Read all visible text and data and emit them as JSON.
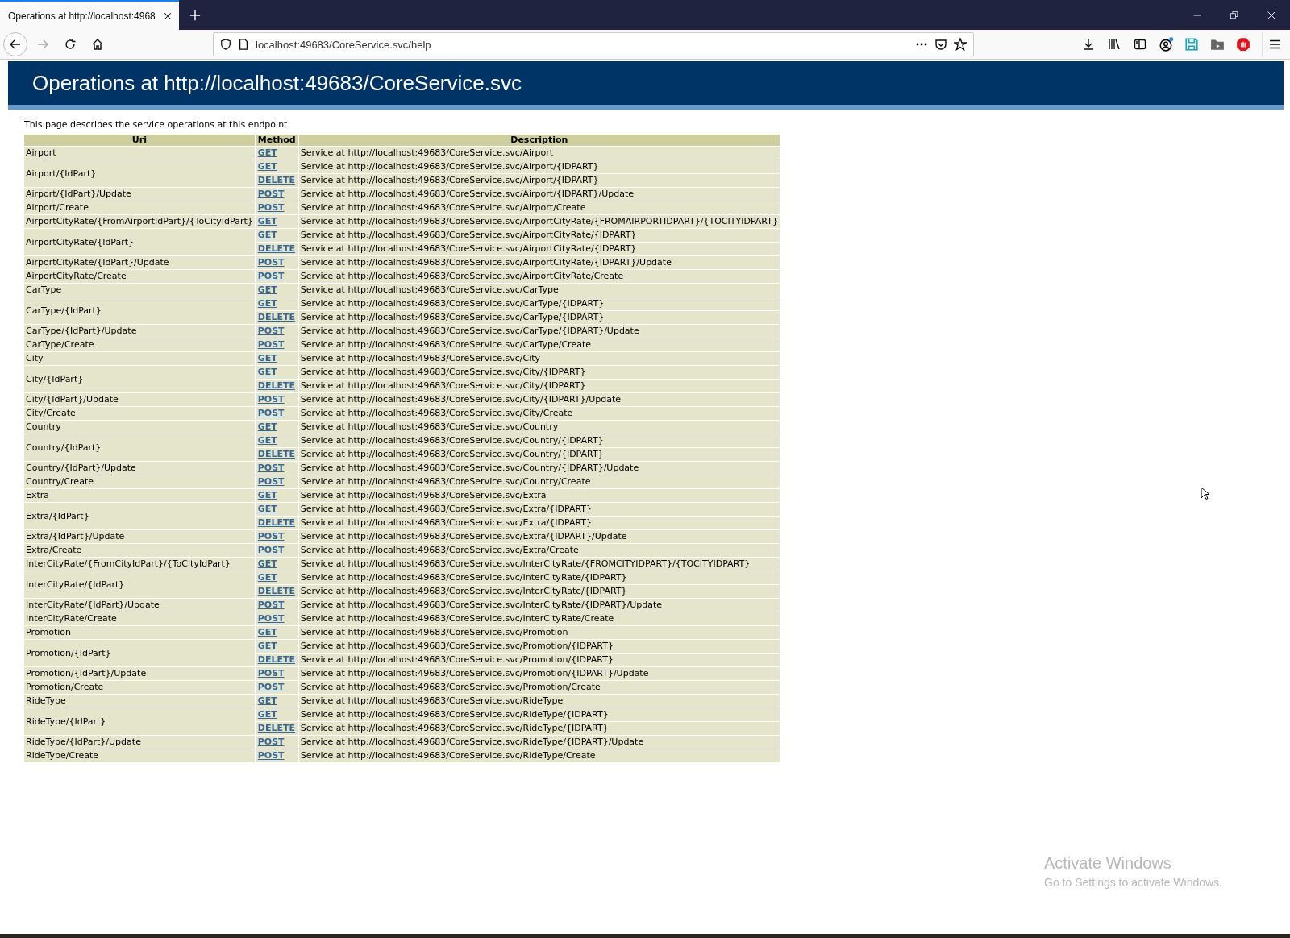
{
  "browser": {
    "tab_title": "Operations at http://localhost:4968",
    "url": "localhost:49683/CoreService.svc/help"
  },
  "page": {
    "title": "Operations at http://localhost:49683/CoreService.svc",
    "intro": "This page describes the service operations at this endpoint.",
    "table": {
      "columns": [
        "Uri",
        "Method",
        "Description"
      ],
      "rows": [
        {
          "uri": "Airport",
          "operations": [
            {
              "method": "GET",
              "description": "Service at http://localhost:49683/CoreService.svc/Airport"
            }
          ]
        },
        {
          "uri": "Airport/{IdPart}",
          "operations": [
            {
              "method": "GET",
              "description": "Service at http://localhost:49683/CoreService.svc/Airport/{IDPART}"
            },
            {
              "method": "DELETE",
              "description": "Service at http://localhost:49683/CoreService.svc/Airport/{IDPART}"
            }
          ]
        },
        {
          "uri": "Airport/{IdPart}/Update",
          "operations": [
            {
              "method": "POST",
              "description": "Service at http://localhost:49683/CoreService.svc/Airport/{IDPART}/Update"
            }
          ]
        },
        {
          "uri": "Airport/Create",
          "operations": [
            {
              "method": "POST",
              "description": "Service at http://localhost:49683/CoreService.svc/Airport/Create"
            }
          ]
        },
        {
          "uri": "AirportCityRate/{FromAirportIdPart}/{ToCityIdPart}",
          "operations": [
            {
              "method": "GET",
              "description": "Service at http://localhost:49683/CoreService.svc/AirportCityRate/{FROMAIRPORTIDPART}/{TOCITYIDPART}"
            }
          ]
        },
        {
          "uri": "AirportCityRate/{IdPart}",
          "operations": [
            {
              "method": "GET",
              "description": "Service at http://localhost:49683/CoreService.svc/AirportCityRate/{IDPART}"
            },
            {
              "method": "DELETE",
              "description": "Service at http://localhost:49683/CoreService.svc/AirportCityRate/{IDPART}"
            }
          ]
        },
        {
          "uri": "AirportCityRate/{IdPart}/Update",
          "operations": [
            {
              "method": "POST",
              "description": "Service at http://localhost:49683/CoreService.svc/AirportCityRate/{IDPART}/Update"
            }
          ]
        },
        {
          "uri": "AirportCityRate/Create",
          "operations": [
            {
              "method": "POST",
              "description": "Service at http://localhost:49683/CoreService.svc/AirportCityRate/Create"
            }
          ]
        },
        {
          "uri": "CarType",
          "operations": [
            {
              "method": "GET",
              "description": "Service at http://localhost:49683/CoreService.svc/CarType"
            }
          ]
        },
        {
          "uri": "CarType/{IdPart}",
          "operations": [
            {
              "method": "GET",
              "description": "Service at http://localhost:49683/CoreService.svc/CarType/{IDPART}"
            },
            {
              "method": "DELETE",
              "description": "Service at http://localhost:49683/CoreService.svc/CarType/{IDPART}"
            }
          ]
        },
        {
          "uri": "CarType/{IdPart}/Update",
          "operations": [
            {
              "method": "POST",
              "description": "Service at http://localhost:49683/CoreService.svc/CarType/{IDPART}/Update"
            }
          ]
        },
        {
          "uri": "CarType/Create",
          "operations": [
            {
              "method": "POST",
              "description": "Service at http://localhost:49683/CoreService.svc/CarType/Create"
            }
          ]
        },
        {
          "uri": "City",
          "operations": [
            {
              "method": "GET",
              "description": "Service at http://localhost:49683/CoreService.svc/City"
            }
          ]
        },
        {
          "uri": "City/{IdPart}",
          "operations": [
            {
              "method": "GET",
              "description": "Service at http://localhost:49683/CoreService.svc/City/{IDPART}"
            },
            {
              "method": "DELETE",
              "description": "Service at http://localhost:49683/CoreService.svc/City/{IDPART}"
            }
          ]
        },
        {
          "uri": "City/{IdPart}/Update",
          "operations": [
            {
              "method": "POST",
              "description": "Service at http://localhost:49683/CoreService.svc/City/{IDPART}/Update"
            }
          ]
        },
        {
          "uri": "City/Create",
          "operations": [
            {
              "method": "POST",
              "description": "Service at http://localhost:49683/CoreService.svc/City/Create"
            }
          ]
        },
        {
          "uri": "Country",
          "operations": [
            {
              "method": "GET",
              "description": "Service at http://localhost:49683/CoreService.svc/Country"
            }
          ]
        },
        {
          "uri": "Country/{IdPart}",
          "operations": [
            {
              "method": "GET",
              "description": "Service at http://localhost:49683/CoreService.svc/Country/{IDPART}"
            },
            {
              "method": "DELETE",
              "description": "Service at http://localhost:49683/CoreService.svc/Country/{IDPART}"
            }
          ]
        },
        {
          "uri": "Country/{IdPart}/Update",
          "operations": [
            {
              "method": "POST",
              "description": "Service at http://localhost:49683/CoreService.svc/Country/{IDPART}/Update"
            }
          ]
        },
        {
          "uri": "Country/Create",
          "operations": [
            {
              "method": "POST",
              "description": "Service at http://localhost:49683/CoreService.svc/Country/Create"
            }
          ]
        },
        {
          "uri": "Extra",
          "operations": [
            {
              "method": "GET",
              "description": "Service at http://localhost:49683/CoreService.svc/Extra"
            }
          ]
        },
        {
          "uri": "Extra/{IdPart}",
          "operations": [
            {
              "method": "GET",
              "description": "Service at http://localhost:49683/CoreService.svc/Extra/{IDPART}"
            },
            {
              "method": "DELETE",
              "description": "Service at http://localhost:49683/CoreService.svc/Extra/{IDPART}"
            }
          ]
        },
        {
          "uri": "Extra/{IdPart}/Update",
          "operations": [
            {
              "method": "POST",
              "description": "Service at http://localhost:49683/CoreService.svc/Extra/{IDPART}/Update"
            }
          ]
        },
        {
          "uri": "Extra/Create",
          "operations": [
            {
              "method": "POST",
              "description": "Service at http://localhost:49683/CoreService.svc/Extra/Create"
            }
          ]
        },
        {
          "uri": "InterCityRate/{FromCityIdPart}/{ToCityIdPart}",
          "operations": [
            {
              "method": "GET",
              "description": "Service at http://localhost:49683/CoreService.svc/InterCityRate/{FROMCITYIDPART}/{TOCITYIDPART}"
            }
          ]
        },
        {
          "uri": "InterCityRate/{IdPart}",
          "operations": [
            {
              "method": "GET",
              "description": "Service at http://localhost:49683/CoreService.svc/InterCityRate/{IDPART}"
            },
            {
              "method": "DELETE",
              "description": "Service at http://localhost:49683/CoreService.svc/InterCityRate/{IDPART}"
            }
          ]
        },
        {
          "uri": "InterCityRate/{IdPart}/Update",
          "operations": [
            {
              "method": "POST",
              "description": "Service at http://localhost:49683/CoreService.svc/InterCityRate/{IDPART}/Update"
            }
          ]
        },
        {
          "uri": "InterCityRate/Create",
          "operations": [
            {
              "method": "POST",
              "description": "Service at http://localhost:49683/CoreService.svc/InterCityRate/Create"
            }
          ]
        },
        {
          "uri": "Promotion",
          "operations": [
            {
              "method": "GET",
              "description": "Service at http://localhost:49683/CoreService.svc/Promotion"
            }
          ]
        },
        {
          "uri": "Promotion/{IdPart}",
          "operations": [
            {
              "method": "GET",
              "description": "Service at http://localhost:49683/CoreService.svc/Promotion/{IDPART}"
            },
            {
              "method": "DELETE",
              "description": "Service at http://localhost:49683/CoreService.svc/Promotion/{IDPART}"
            }
          ]
        },
        {
          "uri": "Promotion/{IdPart}/Update",
          "operations": [
            {
              "method": "POST",
              "description": "Service at http://localhost:49683/CoreService.svc/Promotion/{IDPART}/Update"
            }
          ]
        },
        {
          "uri": "Promotion/Create",
          "operations": [
            {
              "method": "POST",
              "description": "Service at http://localhost:49683/CoreService.svc/Promotion/Create"
            }
          ]
        },
        {
          "uri": "RideType",
          "operations": [
            {
              "method": "GET",
              "description": "Service at http://localhost:49683/CoreService.svc/RideType"
            }
          ]
        },
        {
          "uri": "RideType/{IdPart}",
          "operations": [
            {
              "method": "GET",
              "description": "Service at http://localhost:49683/CoreService.svc/RideType/{IDPART}"
            },
            {
              "method": "DELETE",
              "description": "Service at http://localhost:49683/CoreService.svc/RideType/{IDPART}"
            }
          ]
        },
        {
          "uri": "RideType/{IdPart}/Update",
          "operations": [
            {
              "method": "POST",
              "description": "Service at http://localhost:49683/CoreService.svc/RideType/{IDPART}/Update"
            }
          ]
        },
        {
          "uri": "RideType/Create",
          "operations": [
            {
              "method": "POST",
              "description": "Service at http://localhost:49683/CoreService.svc/RideType/Create"
            }
          ]
        }
      ]
    }
  },
  "watermark": {
    "title": "Activate Windows",
    "subtitle": "Go to Settings to activate Windows."
  }
}
